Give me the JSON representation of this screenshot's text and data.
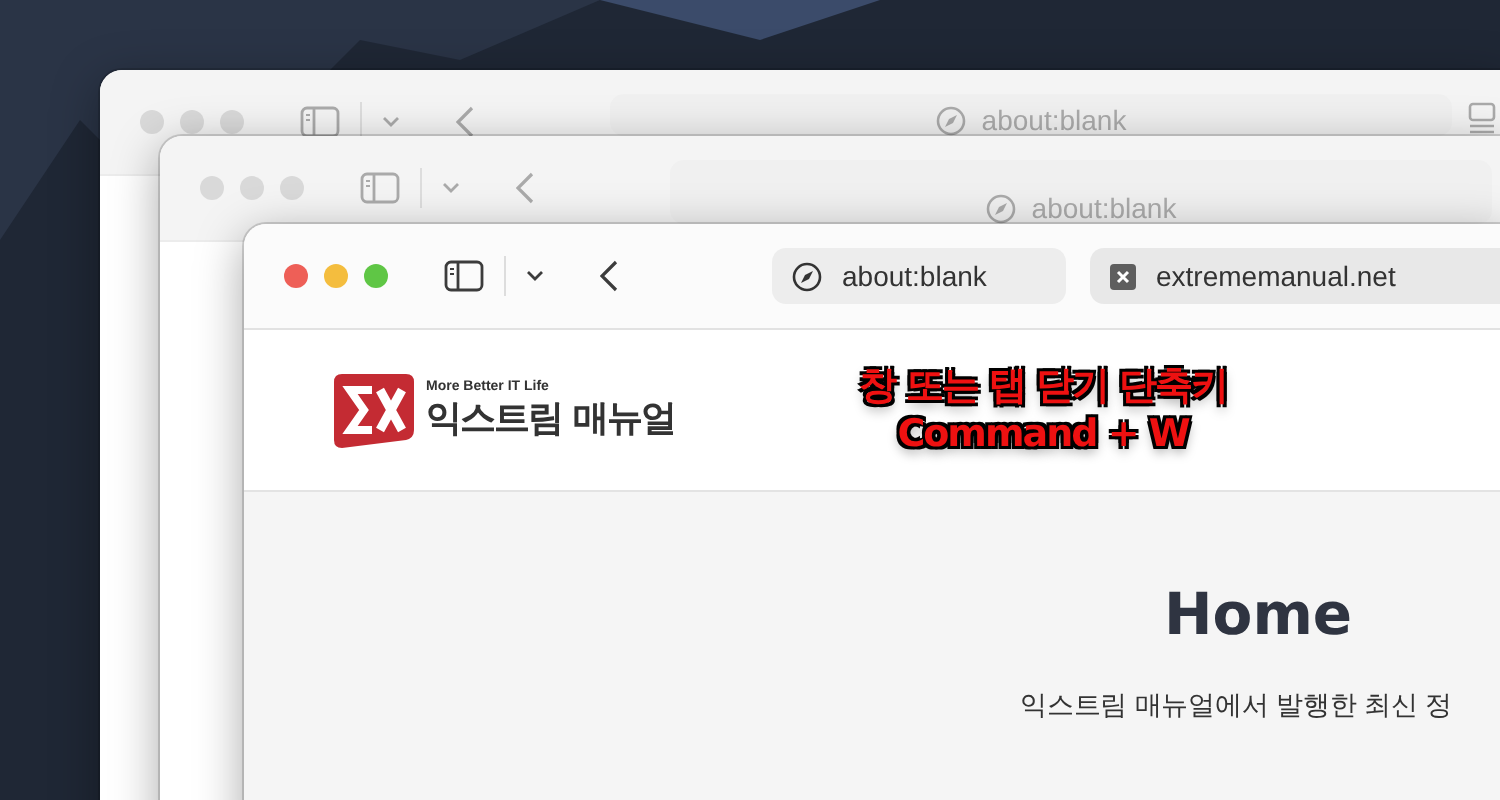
{
  "windows": [
    {
      "active": false,
      "address": "about:blank",
      "tab_overview": true
    },
    {
      "active": false,
      "address": "about:blank",
      "tab_overview": false
    },
    {
      "active": true,
      "tabs": [
        {
          "label": "about:blank",
          "selected": false,
          "kind": "compass"
        },
        {
          "label": "extrememanual.net",
          "selected": true,
          "kind": "favicon"
        }
      ],
      "page": {
        "logo_tagline": "More Better IT Life",
        "logo_name": "익스트림 매뉴얼",
        "annotation": [
          "창 또는 탭 닫기 단축키",
          "Command + W"
        ],
        "heading": "Home",
        "intro": "익스트림 매뉴얼에서 발행한 최신 정"
      }
    }
  ]
}
